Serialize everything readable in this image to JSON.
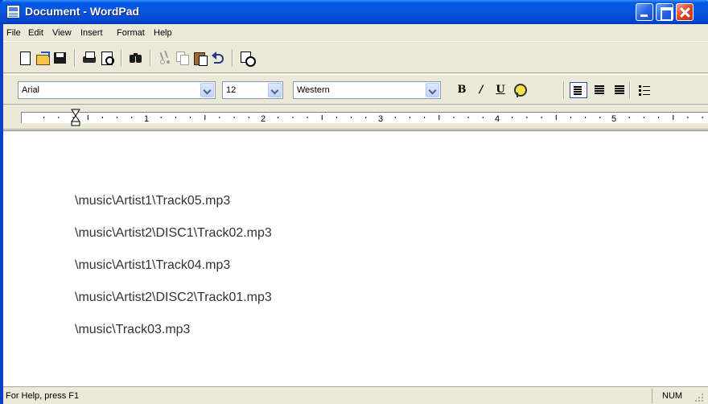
{
  "window": {
    "title": "Document - WordPad"
  },
  "menu": {
    "items": [
      "File",
      "Edit",
      "View",
      "Insert",
      "Format",
      "Help"
    ]
  },
  "toolbar": {
    "icons": [
      "new-document-icon",
      "open-folder-icon",
      "save-icon",
      "print-icon",
      "print-preview-icon",
      "find-icon",
      "cut-icon",
      "copy-icon",
      "paste-icon",
      "undo-icon",
      "date-time-icon"
    ]
  },
  "format_bar": {
    "font": "Arial",
    "size": "12",
    "script": "Western",
    "bold_label": "B",
    "italic_label": "/",
    "underline_label": "U"
  },
  "ruler": {
    "numbers": [
      "1",
      "2",
      "3",
      "4",
      "5"
    ]
  },
  "document": {
    "lines": [
      "\\music\\Artist1\\Track05.mp3",
      "\\music\\Artist2\\DISC1\\Track02.mp3",
      "\\music\\Artist1\\Track04.mp3",
      "\\music\\Artist2\\DISC2\\Track01.mp3",
      "\\music\\Track03.mp3"
    ]
  },
  "status": {
    "help": "For Help, press F1",
    "num": "NUM"
  },
  "colors": {
    "titlebar": "#0A55DD",
    "chrome": "#ECE9D8",
    "close_button": "#D8431F",
    "text": "#333333"
  }
}
